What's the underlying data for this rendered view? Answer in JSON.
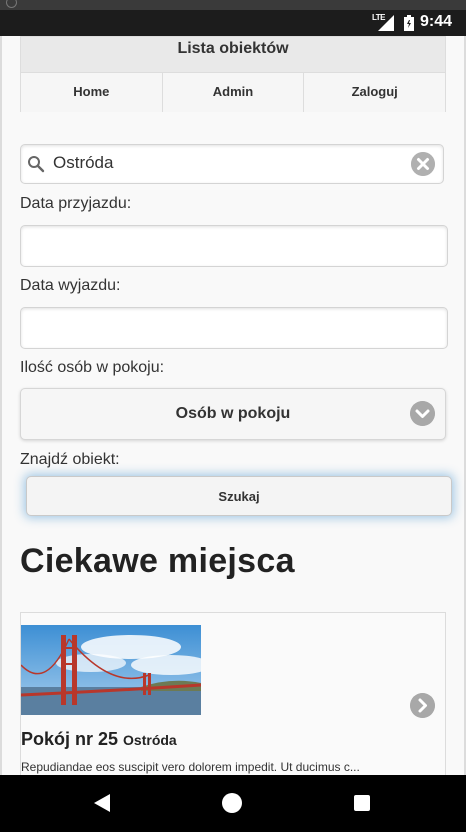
{
  "status_bar": {
    "network": "LTE",
    "time": "9:44"
  },
  "header": {
    "title": "Lista obiektów",
    "nav": [
      {
        "label": "Home"
      },
      {
        "label": "Admin"
      },
      {
        "label": "Zaloguj"
      }
    ]
  },
  "search": {
    "value": "Ostróda",
    "icon": "search-icon",
    "clear_icon": "clear-icon"
  },
  "form": {
    "arrival_label": "Data przyjazdu:",
    "arrival_value": "",
    "departure_label": "Data wyjazdu:",
    "departure_value": "",
    "guests_label": "Ilość osób w pokoju:",
    "guests_select": "Osób w pokoju",
    "find_label": "Znajdź obiekt:",
    "search_button": "Szukaj"
  },
  "section": {
    "title": "Ciekawe miejsca"
  },
  "listing": {
    "title": "Pokój nr 25",
    "town": "Ostróda",
    "description": "Repudiandae eos suscipit vero dolorem impedit. Ut ducimus c...",
    "image_icon": "golden-gate-bridge-photo"
  },
  "colors": {
    "focus_glow": "#388ccb",
    "icon_gray": "#a8a8a8",
    "header_bg": "#e9e9e9"
  }
}
